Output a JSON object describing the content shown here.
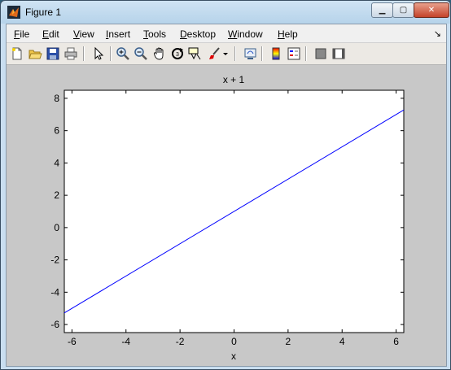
{
  "window": {
    "title": "Figure 1",
    "minimize_icon": "minimize-icon",
    "maximize_icon": "maximize-icon",
    "close_icon": "close-icon"
  },
  "menu": {
    "items": [
      {
        "first": "F",
        "rest": "ile"
      },
      {
        "first": "E",
        "rest": "dit"
      },
      {
        "first": "V",
        "rest": "iew"
      },
      {
        "first": "I",
        "rest": "nsert"
      },
      {
        "first": "T",
        "rest": "ools"
      },
      {
        "first": "D",
        "rest": "esktop"
      },
      {
        "first": "W",
        "rest": "indow"
      },
      {
        "first": "H",
        "rest": "elp"
      }
    ],
    "dock_arrow": "↘"
  },
  "toolbar": {
    "icons": [
      "new-figure-icon",
      "open-file-icon",
      "save-icon",
      "print-icon",
      "edit-plot-arrow-icon",
      "zoom-in-icon",
      "zoom-out-icon",
      "pan-hand-icon",
      "rotate-3d-icon",
      "data-cursor-icon",
      "brush-icon",
      "brush-dropdown-icon",
      "link-plot-icon",
      "colorbar-icon",
      "legend-icon",
      "hide-plot-tools-icon",
      "show-plot-tools-icon"
    ]
  },
  "chart_data": {
    "type": "line",
    "title": "x + 1",
    "xlabel": "x",
    "ylabel": "",
    "xlim": [
      -6.283,
      6.283
    ],
    "ylim": [
      -6.5,
      8.5
    ],
    "xticks": [
      -6,
      -4,
      -2,
      0,
      2,
      4,
      6
    ],
    "yticks": [
      -6,
      -4,
      -2,
      0,
      2,
      4,
      6,
      8
    ],
    "series": [
      {
        "color": "#0000ff",
        "x": [
          -6.283,
          6.283
        ],
        "y": [
          -5.283,
          7.283
        ]
      }
    ],
    "grid": false
  }
}
